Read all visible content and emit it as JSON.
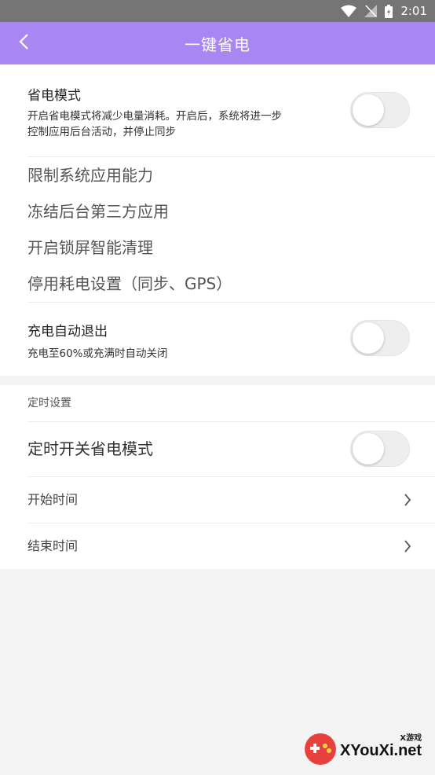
{
  "status_bar": {
    "time": "2:01"
  },
  "header": {
    "title": "一键省电",
    "back_icon": "chevron-left-icon"
  },
  "power_saving": {
    "title": "省电模式",
    "desc_line1": "开启省电模式将减少电量消耗。开启后，系统将进一步",
    "desc_line2": "控制应用后台活动，并停止同步",
    "enabled": false
  },
  "features": [
    "限制系统应用能力",
    "冻结后台第三方应用",
    "开启锁屏智能清理",
    "停用耗电设置（同步、GPS）"
  ],
  "charge_exit": {
    "title": "充电自动退出",
    "desc": "充电至60%或充满时自动关闭",
    "enabled": false
  },
  "schedule": {
    "section_title": "定时设置",
    "toggle_title": "定时开关省电模式",
    "enabled": false,
    "start_label": "开始时间",
    "end_label": "结束时间"
  },
  "watermark": {
    "brand": "XYouXi.net",
    "sub": "X游戏"
  },
  "colors": {
    "header": "#a987f3",
    "status_bar": "#757575"
  }
}
